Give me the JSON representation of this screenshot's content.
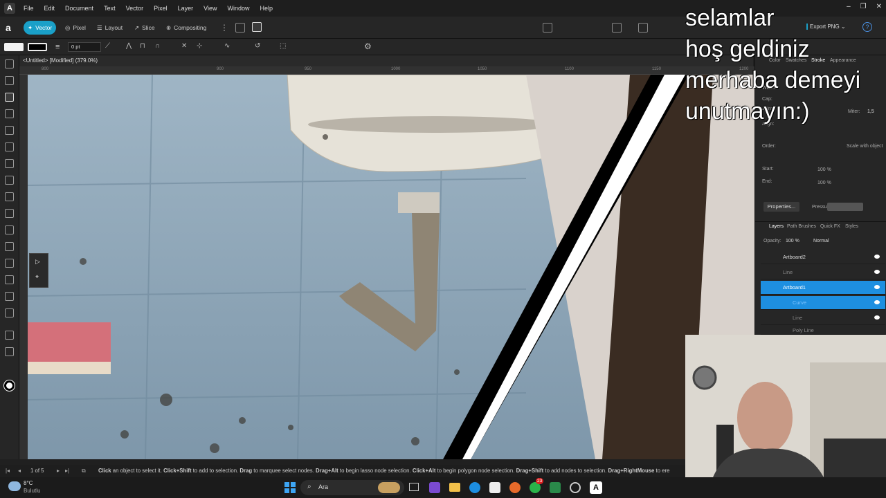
{
  "app": {
    "logo": "A",
    "menus": [
      "File",
      "Edit",
      "Document",
      "Text",
      "Vector",
      "Pixel",
      "Layer",
      "View",
      "Window",
      "Help"
    ]
  },
  "personas": [
    {
      "label": "Vector",
      "active": true
    },
    {
      "label": "Pixel",
      "active": false
    },
    {
      "label": "Layout",
      "active": false
    },
    {
      "label": "Slice",
      "active": false
    },
    {
      "label": "Compositing",
      "active": false
    }
  ],
  "context": {
    "stroke_width": "0 pt",
    "export_label": "Export PNG"
  },
  "document": {
    "tab_title": "<Untitled> [Modified] (379.0%)"
  },
  "ruler_ticks": [
    "800",
    "900",
    "950",
    "1000",
    "1050",
    "1100",
    "1150",
    "1200"
  ],
  "panel": {
    "top_tabs": [
      "Color",
      "Swatches",
      "Stroke",
      "Appearance"
    ],
    "width_label": "Width:",
    "cap_label": "Cap:",
    "join_label": "Join:",
    "align_label": "Align:",
    "miter_label": "Miter:",
    "miter_value": "1,5",
    "order_label": "Order:",
    "scale_label": "Scale with object",
    "start_label": "Start:",
    "end_label": "End:",
    "start_pct": "100 %",
    "end_pct": "100 %",
    "properties_btn": "Properties...",
    "pressure_label": "Pressure:",
    "bottom_tabs": [
      "Layers",
      "Path Brushes",
      "Quick FX",
      "Styles"
    ],
    "opacity_label": "Opacity:",
    "opacity_value": "100 %",
    "blend_mode": "Normal",
    "layers": [
      {
        "name": "Artboard2",
        "state": "normal"
      },
      {
        "name": "Line",
        "state": "dim"
      },
      {
        "name": "Artboard1",
        "state": "selected"
      },
      {
        "name": "Curve",
        "state": "selected-child"
      },
      {
        "name": "Line",
        "state": "dim"
      },
      {
        "name": "Poly Line",
        "state": "dim"
      }
    ]
  },
  "status": {
    "page": "1 of 5",
    "parts": [
      {
        "b": "Click",
        "t": " an object to select it. "
      },
      {
        "b": "Click+Shift",
        "t": " to add to selection. "
      },
      {
        "b": "Drag",
        "t": " to marquee select nodes. "
      },
      {
        "b": "Drag+Alt",
        "t": " to begin lasso node selection. "
      },
      {
        "b": "Click+Alt",
        "t": " to begin polygon node selection. "
      },
      {
        "b": "Drag+Shift",
        "t": " to add nodes to selection. "
      },
      {
        "b": "Drag+RightMouse",
        "t": " to ere"
      }
    ]
  },
  "overlay_text": [
    "selamlar",
    "hoş geldiniz",
    "merhaba demeyi",
    "unutmayın:)"
  ],
  "taskbar": {
    "weather_temp": "8°C",
    "weather_desc": "Bulutlu",
    "search_placeholder": "Ara",
    "badge_whatsapp": "23"
  }
}
